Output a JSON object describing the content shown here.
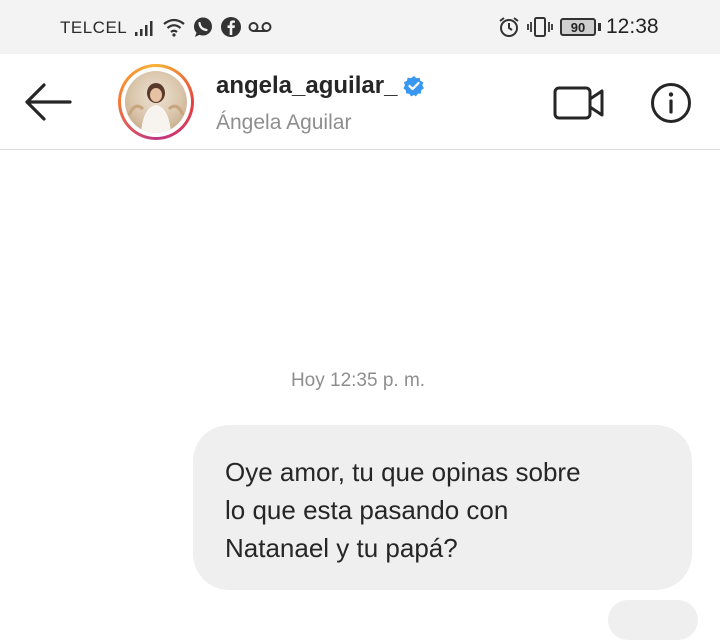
{
  "status_bar": {
    "carrier": "TELCEL",
    "battery": "90",
    "time": "12:38",
    "icons": [
      "signal-icon",
      "wifi-icon",
      "whatsapp-icon",
      "facebook-icon",
      "voicemail-icon",
      "alarm-icon",
      "vibrate-icon"
    ]
  },
  "header": {
    "username": "angela_aguilar_",
    "full_name": "Ángela Aguilar",
    "verified": true,
    "icons": [
      "back-arrow-icon",
      "video-call-icon",
      "info-icon"
    ]
  },
  "conversation": {
    "timestamp": "Hoy 12:35 p. m.",
    "messages": [
      {
        "sender": "me",
        "text": "Oye amor, tu que opinas sobre\nlo que esta pasando con\nNatanael y tu papá?"
      }
    ]
  },
  "colors": {
    "verified_blue": "#3897f0",
    "bubble_gray": "#efefef",
    "secondary_text": "#8e8e8e"
  }
}
